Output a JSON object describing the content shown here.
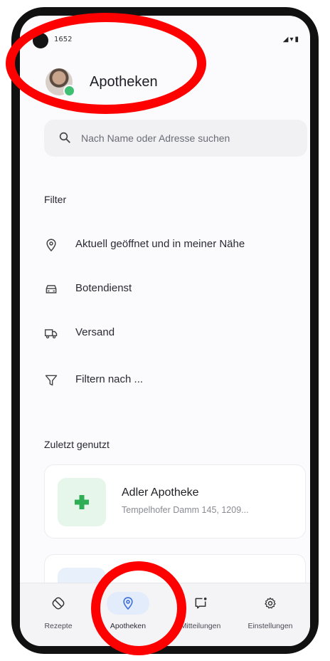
{
  "status_bar": {
    "time": "1652",
    "icons": "◢▾▮"
  },
  "header": {
    "title": "Apotheken"
  },
  "search": {
    "placeholder": "Nach Name oder Adresse suchen"
  },
  "filter": {
    "heading": "Filter",
    "items": [
      {
        "label": "Aktuell geöffnet und in meiner Nähe",
        "icon": "location-pin-icon"
      },
      {
        "label": "Botendienst",
        "icon": "car-icon"
      },
      {
        "label": "Versand",
        "icon": "truck-icon"
      },
      {
        "label": "Filtern nach ...",
        "icon": "funnel-icon"
      }
    ]
  },
  "recent": {
    "heading": "Zuletzt genutzt",
    "cards": [
      {
        "name": "Adler Apotheke",
        "address": "Tempelhofer Damm 145, 1209..."
      }
    ]
  },
  "bottom_nav": {
    "items": [
      {
        "label": "Rezepte",
        "icon": "prescription-icon"
      },
      {
        "label": "Apotheken",
        "icon": "location-pin-icon",
        "active": true
      },
      {
        "label": "Mitteilungen",
        "icon": "message-icon"
      },
      {
        "label": "Einstellungen",
        "icon": "gear-icon"
      }
    ]
  },
  "colors": {
    "accent": "#3d6fd8",
    "pharmacy_green": "#2fae55",
    "annotation": "#ff0000"
  }
}
